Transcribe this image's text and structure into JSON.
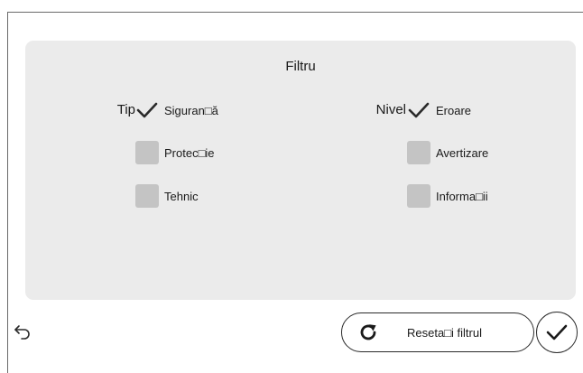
{
  "panel": {
    "title": "Filtru"
  },
  "groups": {
    "tip": {
      "label": "Tip",
      "options": [
        {
          "label": "Siguran□ă",
          "checked": true
        },
        {
          "label": "Protec□ie",
          "checked": false
        },
        {
          "label": "Tehnic",
          "checked": false
        }
      ]
    },
    "nivel": {
      "label": "Nivel",
      "options": [
        {
          "label": "Eroare",
          "checked": true
        },
        {
          "label": "Avertizare",
          "checked": false
        },
        {
          "label": "Informa□ii",
          "checked": false
        }
      ]
    }
  },
  "footer": {
    "back_icon": "back-arrow-icon",
    "reset_icon": "refresh-icon",
    "reset_label": "Reseta□i filtrul",
    "confirm_icon": "checkmark-icon"
  },
  "colors": {
    "panel_bg": "#ebebeb",
    "checkbox_off": "#c4c4c4",
    "text": "#1a1a1a"
  }
}
